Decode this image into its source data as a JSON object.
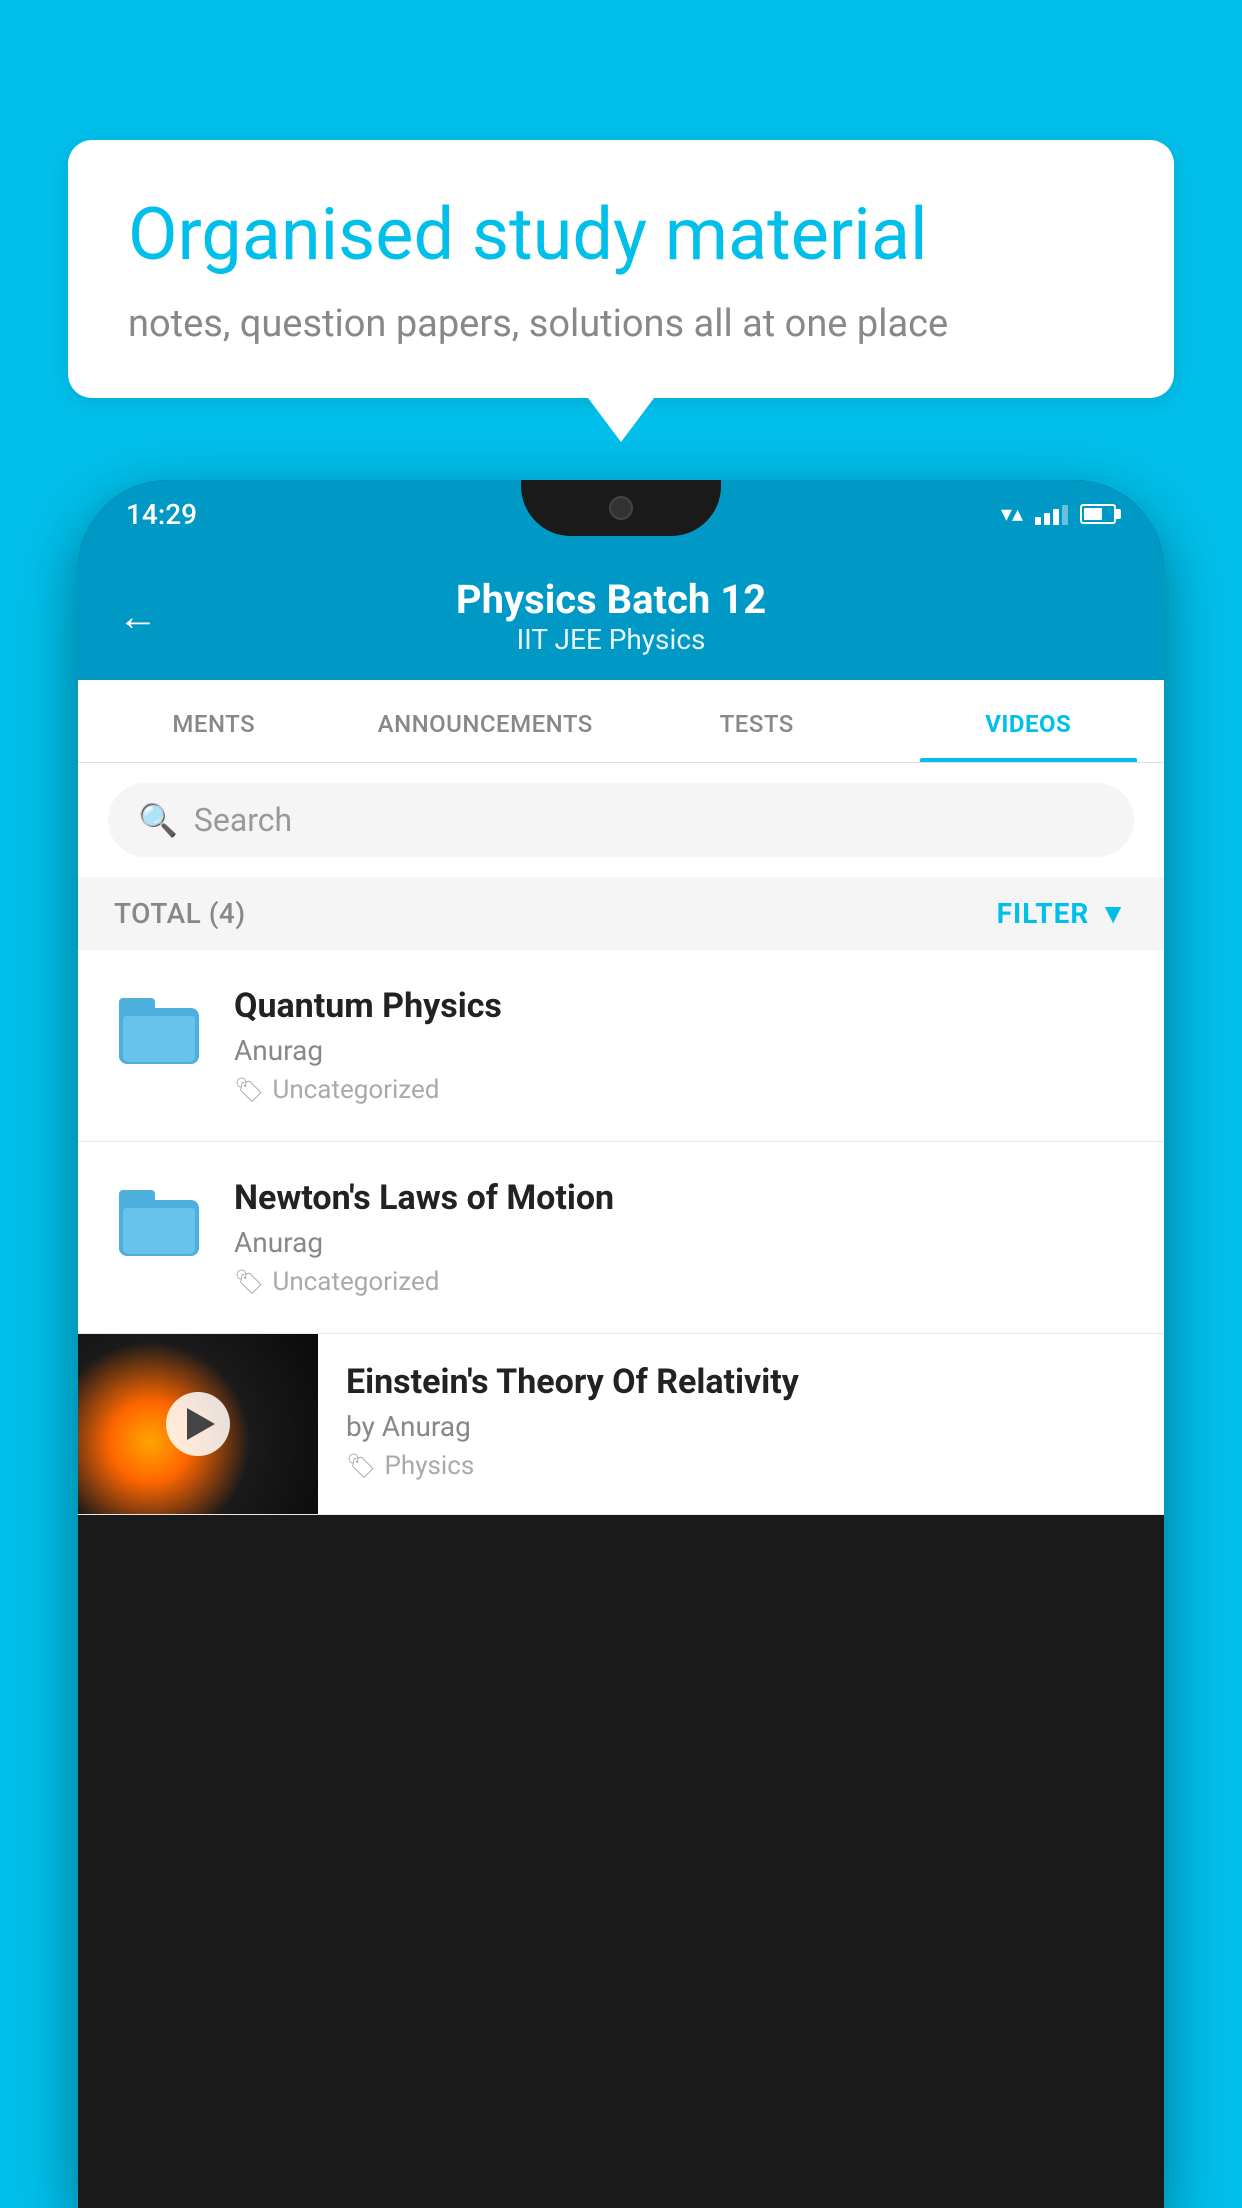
{
  "background_color": "#00BFEA",
  "speech_bubble": {
    "title": "Organised study material",
    "subtitle": "notes, question papers, solutions all at one place"
  },
  "status_bar": {
    "time": "14:29",
    "wifi": "▼",
    "battery_percent": 65
  },
  "app_header": {
    "back_label": "←",
    "title": "Physics Batch 12",
    "subtitle": "IIT JEE   Physics"
  },
  "tabs": [
    {
      "label": "MENTS",
      "active": false
    },
    {
      "label": "ANNOUNCEMENTS",
      "active": false
    },
    {
      "label": "TESTS",
      "active": false
    },
    {
      "label": "VIDEOS",
      "active": true
    }
  ],
  "search": {
    "placeholder": "Search"
  },
  "total_bar": {
    "label": "TOTAL (4)",
    "filter_label": "FILTER"
  },
  "videos": [
    {
      "type": "folder",
      "title": "Quantum Physics",
      "author": "Anurag",
      "tag": "Uncategorized"
    },
    {
      "type": "folder",
      "title": "Newton's Laws of Motion",
      "author": "Anurag",
      "tag": "Uncategorized"
    },
    {
      "type": "thumbnail",
      "title": "Einstein's Theory Of Relativity",
      "author": "by Anurag",
      "tag": "Physics"
    }
  ]
}
